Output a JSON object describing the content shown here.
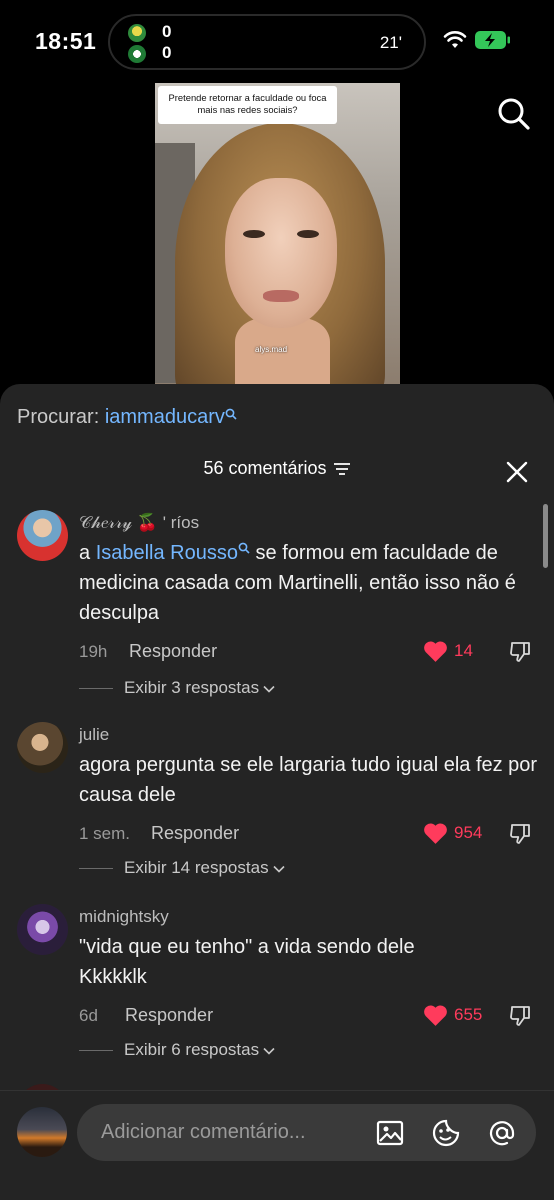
{
  "status_bar": {
    "time": "18:51",
    "score_home": "0",
    "score_away": "0",
    "match_time": "21'"
  },
  "video": {
    "question": "Pretende retornar a faculdade ou foca mais nas redes sociais?",
    "watermark": "alys.mad"
  },
  "sheet": {
    "search_prefix": "Procurar:",
    "search_keyword": "iammaducarv",
    "comments_count_label": "56 comentários"
  },
  "comments": [
    {
      "username": "𝒞𝒽𝑒𝓇𝓇𝓎 🍒 ' ríos",
      "mention": "Isabella Rousso",
      "text_before": "a ",
      "text_after": " se formou em faculdade de medicina casada com Martinelli, então isso não é desculpa",
      "time": "19h",
      "reply_label": "Responder",
      "likes": "14",
      "view_replies": "Exibir 3 respostas"
    },
    {
      "username": "julie",
      "text": "agora pergunta se ele largaria tudo igual ela fez por causa dele",
      "time": "1 sem.",
      "reply_label": "Responder",
      "likes": "954",
      "view_replies": "Exibir 14 respostas"
    },
    {
      "username": "midnightsky",
      "text": "\"vida que eu tenho\" a vida sendo dele Kkkkklk",
      "time": "6d",
      "reply_label": "Responder",
      "likes": "655",
      "view_replies": "Exibir 6 respostas"
    }
  ],
  "input": {
    "placeholder": "Adicionar comentário..."
  },
  "colors": {
    "link": "#74b7ff",
    "like": "#ff3b5c",
    "sheet_bg": "#242424"
  }
}
